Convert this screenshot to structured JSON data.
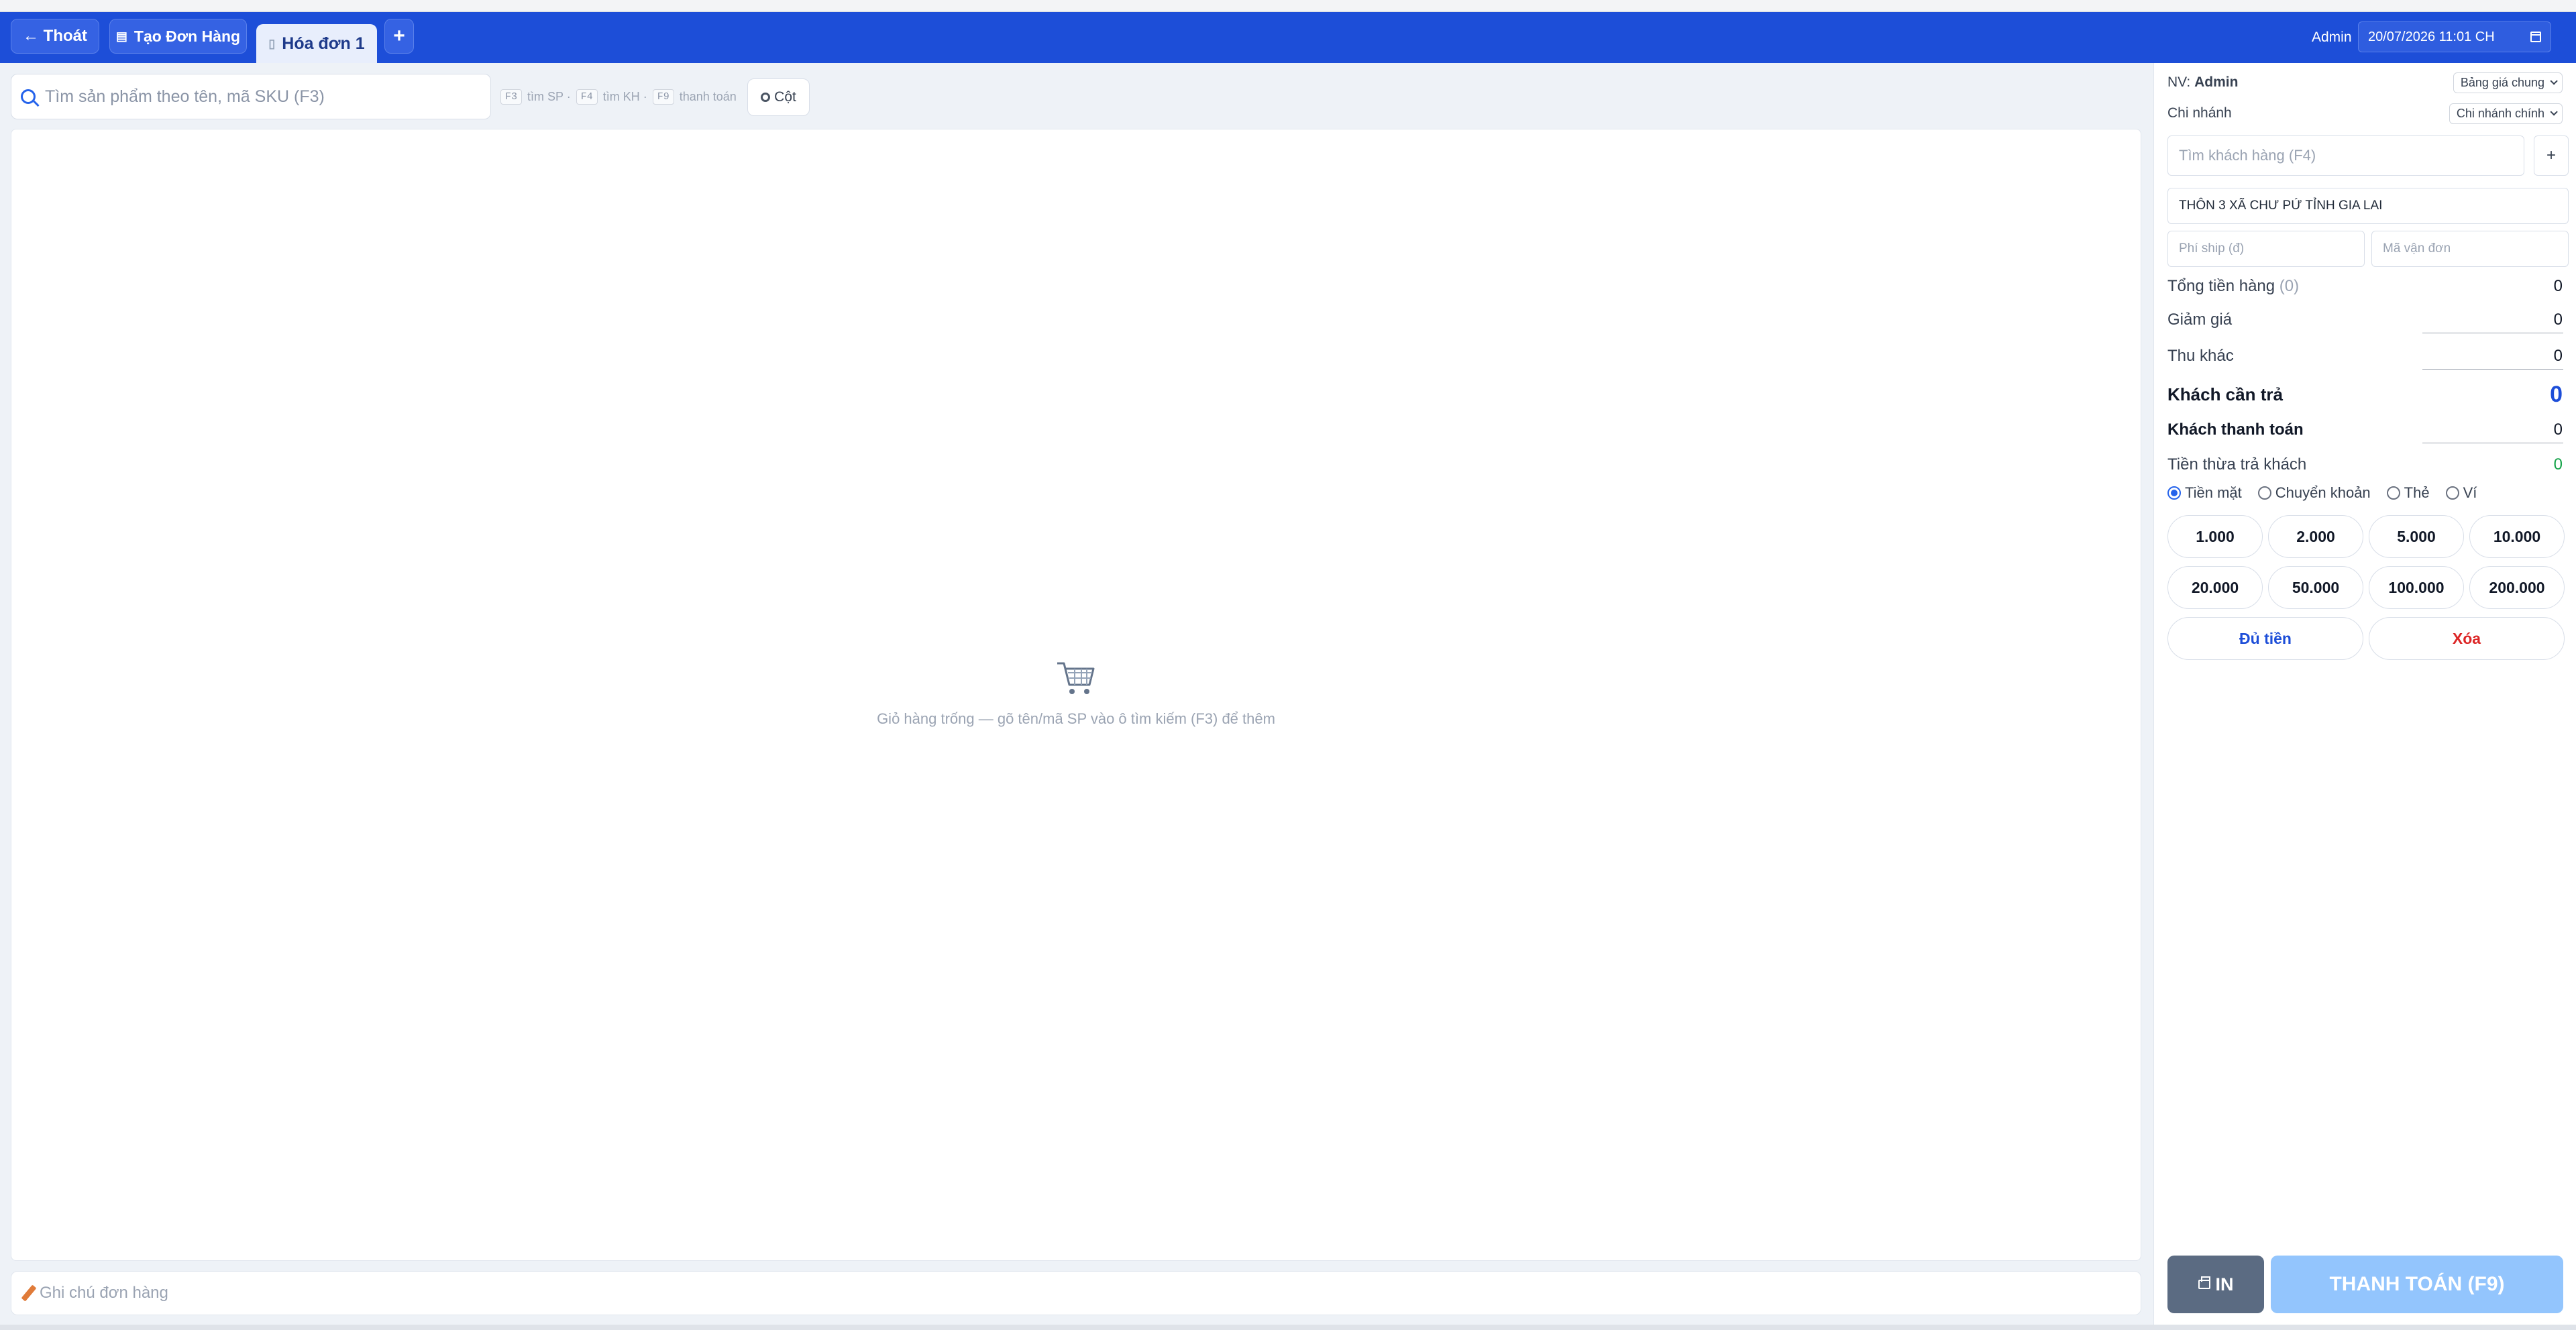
{
  "header": {
    "exit_label": "← Thoát",
    "create_order_label": "Tạo Đơn Hàng",
    "active_tab_label": "Hóa đơn 1",
    "add_tab_label": "+",
    "user_label": "Admin",
    "datetime_value": "20/07/2026 11:01 CH"
  },
  "search": {
    "placeholder": "Tìm sản phẩm theo tên, mã SKU (F3)",
    "hints": [
      {
        "key": "F3",
        "text": "tìm SP ·"
      },
      {
        "key": "F4",
        "text": "tìm KH ·"
      },
      {
        "key": "F9",
        "text": "thanh toán"
      }
    ],
    "columns_label": "Cột"
  },
  "cart": {
    "empty_text": "Giỏ hàng trống — gõ tên/mã SP vào ô tìm kiếm (F3) để thêm"
  },
  "note": {
    "placeholder": "Ghi chú đơn hàng"
  },
  "panel": {
    "staff_prefix": "NV:",
    "staff_name": "Admin",
    "price_list": "Bảng giá chung",
    "branch_label": "Chi nhánh",
    "branch_value": "Chi nhánh chính",
    "customer_placeholder": "Tìm khách hàng (F4)",
    "customer_add": "+",
    "address": "THÔN 3 XÃ CHƯ PỨ TỈNH GIA LAI",
    "ship_fee_placeholder": "Phí ship (đ)",
    "tracking_placeholder": "Mã vận đơn",
    "summary": {
      "subtotal_label": "Tổng tiền hàng",
      "subtotal_count": "(0)",
      "subtotal_value": "0",
      "discount_label": "Giảm giá",
      "discount_value": "0",
      "other_label": "Thu khác",
      "other_value": "0",
      "due_label": "Khách cần trả",
      "due_value": "0",
      "paid_label": "Khách thanh toán",
      "paid_value": "0",
      "change_label": "Tiền thừa trả khách",
      "change_value": "0"
    },
    "payment_methods": [
      "Tiền mặt",
      "Chuyển khoản",
      "Thẻ",
      "Ví"
    ],
    "selected_payment": "Tiền mặt",
    "quick_amounts": [
      "1.000",
      "2.000",
      "5.000",
      "10.000",
      "20.000",
      "50.000",
      "100.000",
      "200.000"
    ],
    "exact_label": "Đủ tiền",
    "clear_label": "Xóa",
    "print_label": "IN",
    "checkout_label": "THANH TOÁN (F9)"
  },
  "colors": {
    "header_bg": "#1d4ed8",
    "accent": "#2563eb",
    "checkout_disabled": "#93c5fd",
    "danger": "#dc2626",
    "success": "#16a34a"
  }
}
